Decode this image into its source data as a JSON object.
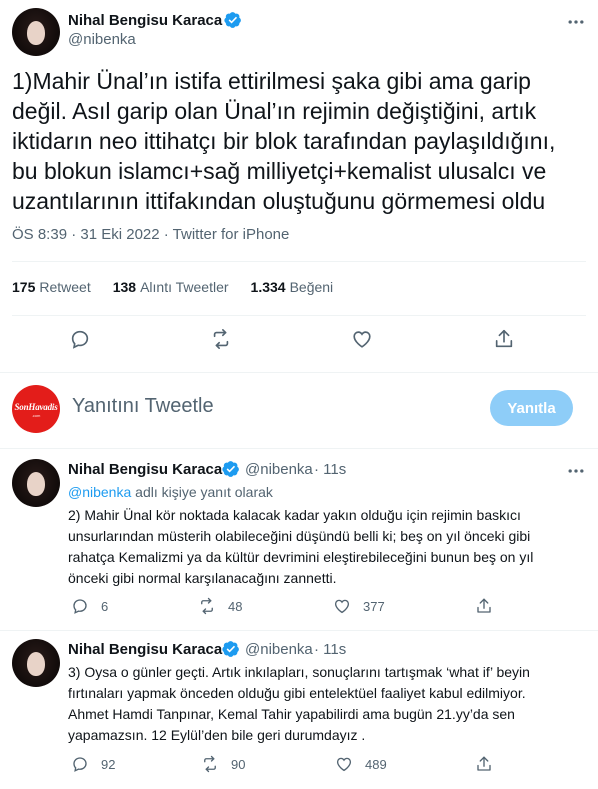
{
  "main_tweet": {
    "author_name": "Nihal Bengisu Karaca",
    "handle": "@nibenka",
    "text_lines": [
      "1)Mahir Ünal’ın istifa ettirilmesi şaka gibi ama  garip",
      "değil. Asıl garip olan Ünal’ın rejimin değiştiğini, artık",
      "iktidarın neo ittihatçı bir blok tarafından paylaşıldığını,",
      "bu blokun islamcı+sağ milliyetçi+kemalist ulusalcı ve",
      "uzantılarının ittifakından oluştuğunu görmemesi oldu"
    ],
    "meta": "ÖS 8:39 · 31 Eki 2022 · Twitter for iPhone",
    "stats": {
      "retweets": "175",
      "retweets_label": "Retweet",
      "quotes": "138",
      "quotes_label": "Alıntı Tweetler",
      "likes": "1.334",
      "likes_label": "Beğeni"
    },
    "actions": [
      "reply-icon",
      "retweet-icon",
      "like-icon",
      "share-icon"
    ]
  },
  "composer": {
    "avatar_brand": "SonHavadis",
    "avatar_brand_sub": ".com",
    "placeholder": "Yanıtını Tweetle",
    "button_label": "Yanıtla",
    "button_color": "#8ecdf8"
  },
  "replies": [
    {
      "author_name": "Nihal Bengisu Karaca",
      "handle": "@nibenka",
      "time": "· 11s",
      "replying_prefix": "@nibenka",
      "replying_suffix": " adlı kişiye yanıt olarak",
      "text_lines": [
        "2) Mahir Ünal kör noktada kalacak kadar yakın olduğu için rejimin baskıcı",
        "unsurlarından müsterih olabileceğini düşündü belli ki; beş on yıl önceki gibi",
        "rahatça Kemalizmi ya da kültür devrimini eleştirebileceğini bunun beş on yıl",
        "önceki gibi normal karşılanacağını zannetti."
      ],
      "replies_count": "6",
      "retweets_count": "48",
      "likes_count": "377"
    },
    {
      "author_name": "Nihal Bengisu Karaca",
      "handle": "@nibenka",
      "time": "· 11s",
      "text_lines": [
        "3) Oysa o günler geçti. Artık inkılapları, sonuçlarını tartışmak ‘what if’ beyin",
        "fırtınaları yapmak önceden olduğu gibi entelektüel faaliyet kabul edilmiyor.",
        "Ahmet Hamdi Tanpınar, Kemal Tahir yapabilirdi ama bugün 21.yy’da sen",
        "yapamazsın. 12 Eylül’den bile geri durumdayız ."
      ],
      "replies_count": "92",
      "retweets_count": "90",
      "likes_count": "489"
    }
  ],
  "colors": {
    "verified": "#1d9bf0",
    "text_primary": "#0f1419",
    "text_secondary": "#536471",
    "brand_red": "#e31d1a"
  }
}
